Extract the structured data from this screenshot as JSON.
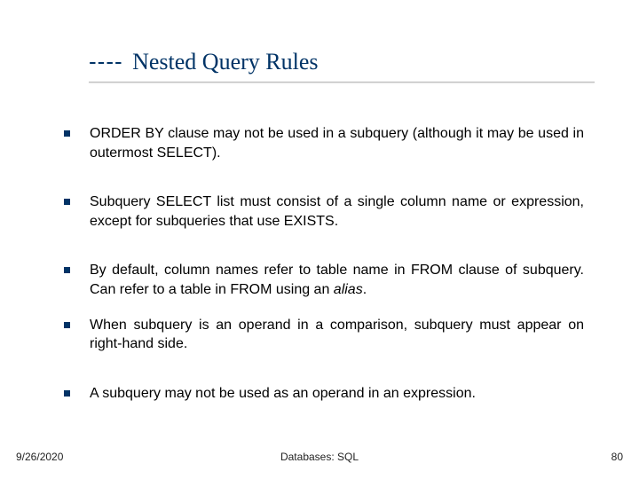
{
  "title": {
    "dashes": "----",
    "text": "Nested Query Rules"
  },
  "bullets": [
    {
      "text": "ORDER BY clause may not be used in a subquery (although it may be used in outermost SELECT)."
    },
    {
      "text": "Subquery SELECT list must consist of a single column name or expression, except for subqueries that use EXISTS."
    },
    {
      "text_pre": "By default, column names refer to table name in FROM clause of subquery. Can refer to a table in FROM using an ",
      "text_italic": "alias",
      "text_post": "."
    },
    {
      "text": "When subquery is an operand in a comparison, subquery must appear on right-hand side."
    },
    {
      "text": "A subquery may not be used as an operand in an expression."
    }
  ],
  "footer": {
    "date": "9/26/2020",
    "center": "Databases: SQL",
    "page": "80"
  }
}
